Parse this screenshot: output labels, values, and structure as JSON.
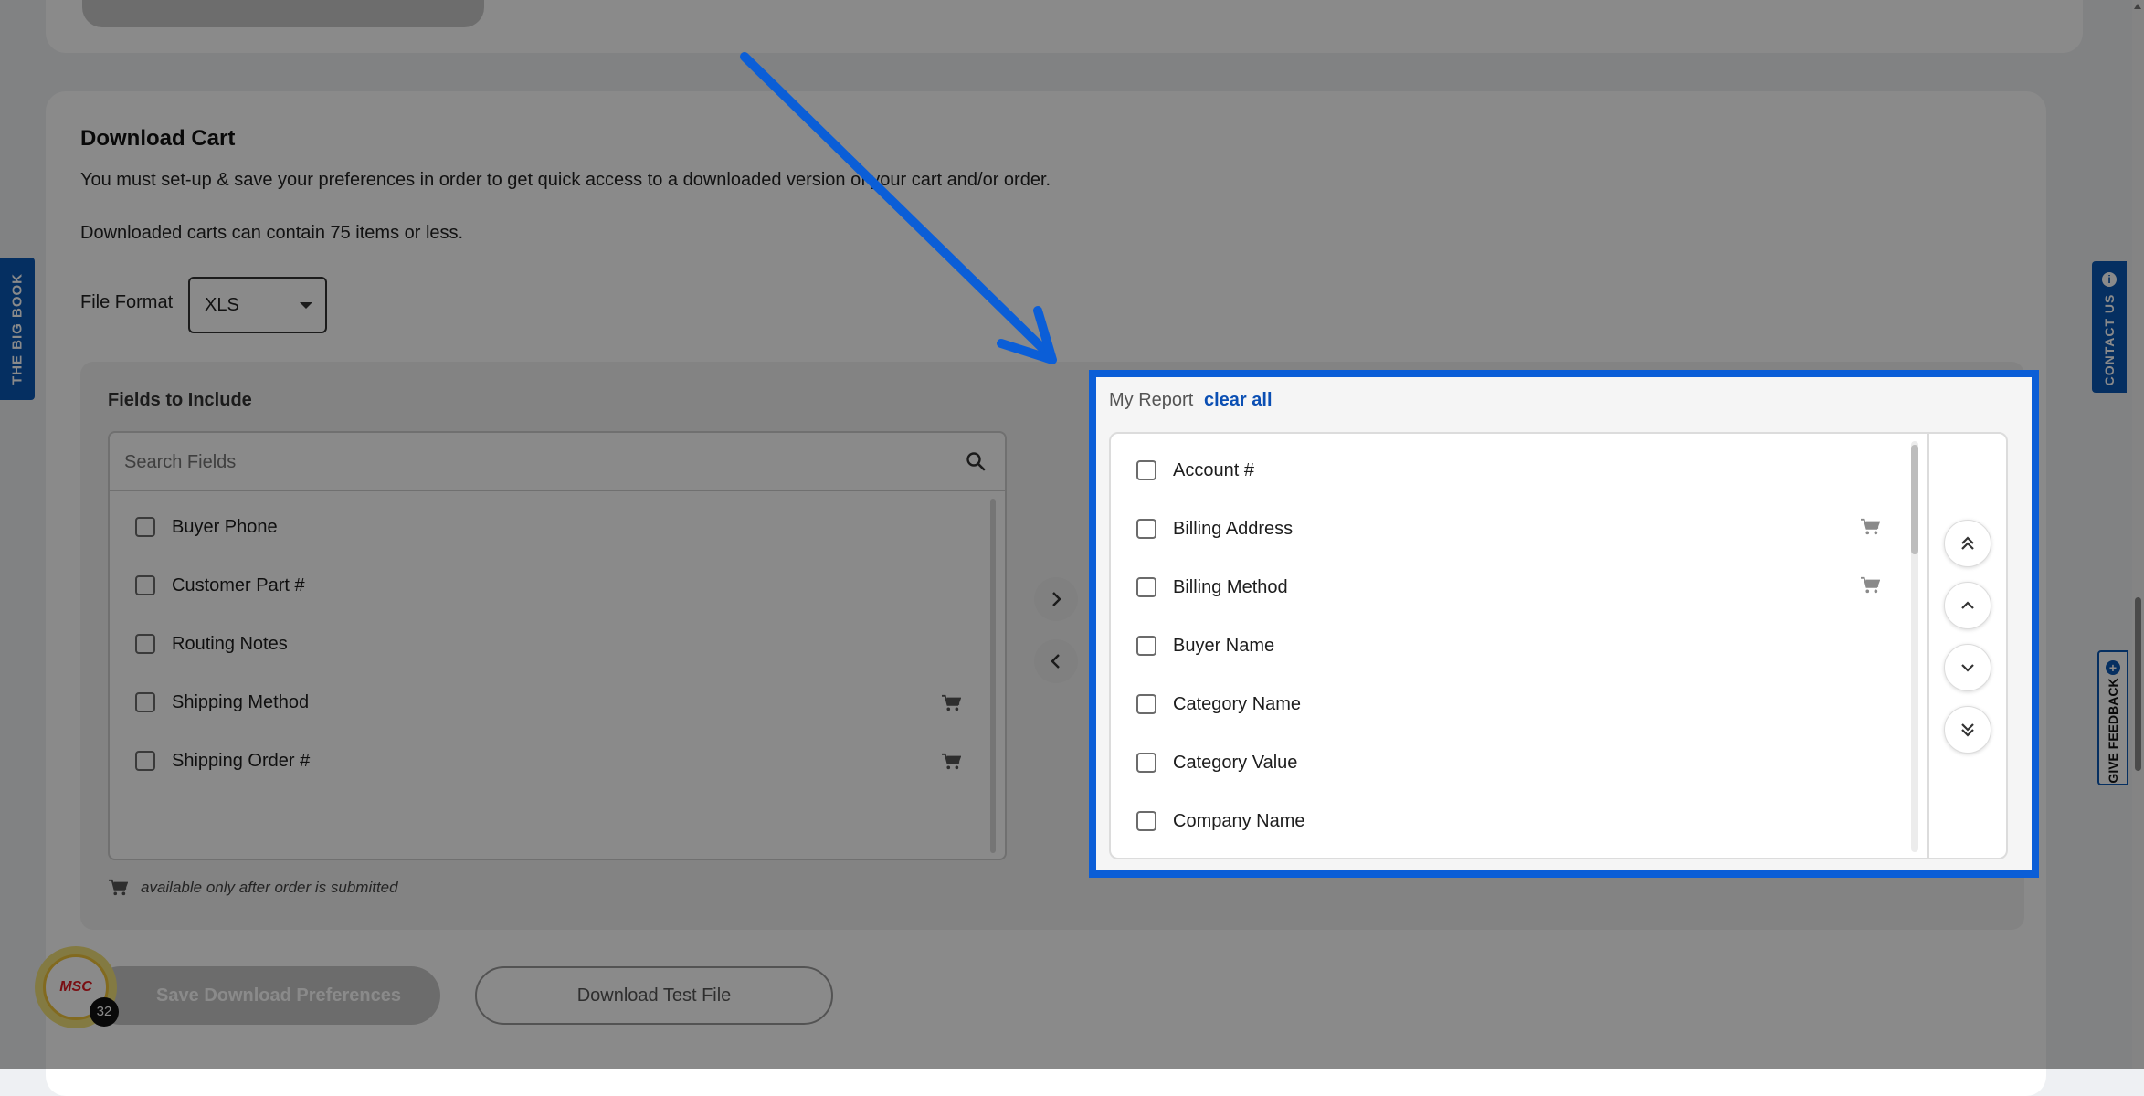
{
  "download_cart": {
    "title": "Download Cart",
    "description": "You must set-up & save your preferences in order to get quick access to a downloaded version of your cart and/or order.",
    "limit_note": "Downloaded carts can contain 75 items or less.",
    "file_format_label": "File Format",
    "file_format_value": "XLS"
  },
  "fields_panel": {
    "title": "Fields to Include",
    "search_placeholder": "Search Fields",
    "items": [
      {
        "label": "Buyer Phone",
        "cart": false
      },
      {
        "label": "Customer Part #",
        "cart": false
      },
      {
        "label": "Routing Notes",
        "cart": false
      },
      {
        "label": "Shipping Method",
        "cart": true
      },
      {
        "label": "Shipping Order #",
        "cart": true
      }
    ],
    "legend_note": "available only after order is submitted"
  },
  "report_panel": {
    "title": "My Report",
    "clear_all": "clear all",
    "items": [
      {
        "label": "Account #",
        "cart": false
      },
      {
        "label": "Billing Address",
        "cart": true
      },
      {
        "label": "Billing Method",
        "cart": true
      },
      {
        "label": "Buyer Name",
        "cart": false
      },
      {
        "label": "Category Name",
        "cart": false
      },
      {
        "label": "Category Value",
        "cart": false
      },
      {
        "label": "Company Name",
        "cart": false
      }
    ]
  },
  "buttons": {
    "save": "Save Download Preferences",
    "test_file": "Download Test File"
  },
  "side_tabs": {
    "left": "THE BIG BOOK",
    "contact": "CONTACT US",
    "feedback": "GIVE FEEDBACK"
  },
  "badge": {
    "logo": "MSC",
    "count": "32"
  },
  "colors": {
    "highlight_blue": "#0b5ed7",
    "link_blue": "#0b4fb3",
    "tab_blue": "#0b57b3"
  }
}
